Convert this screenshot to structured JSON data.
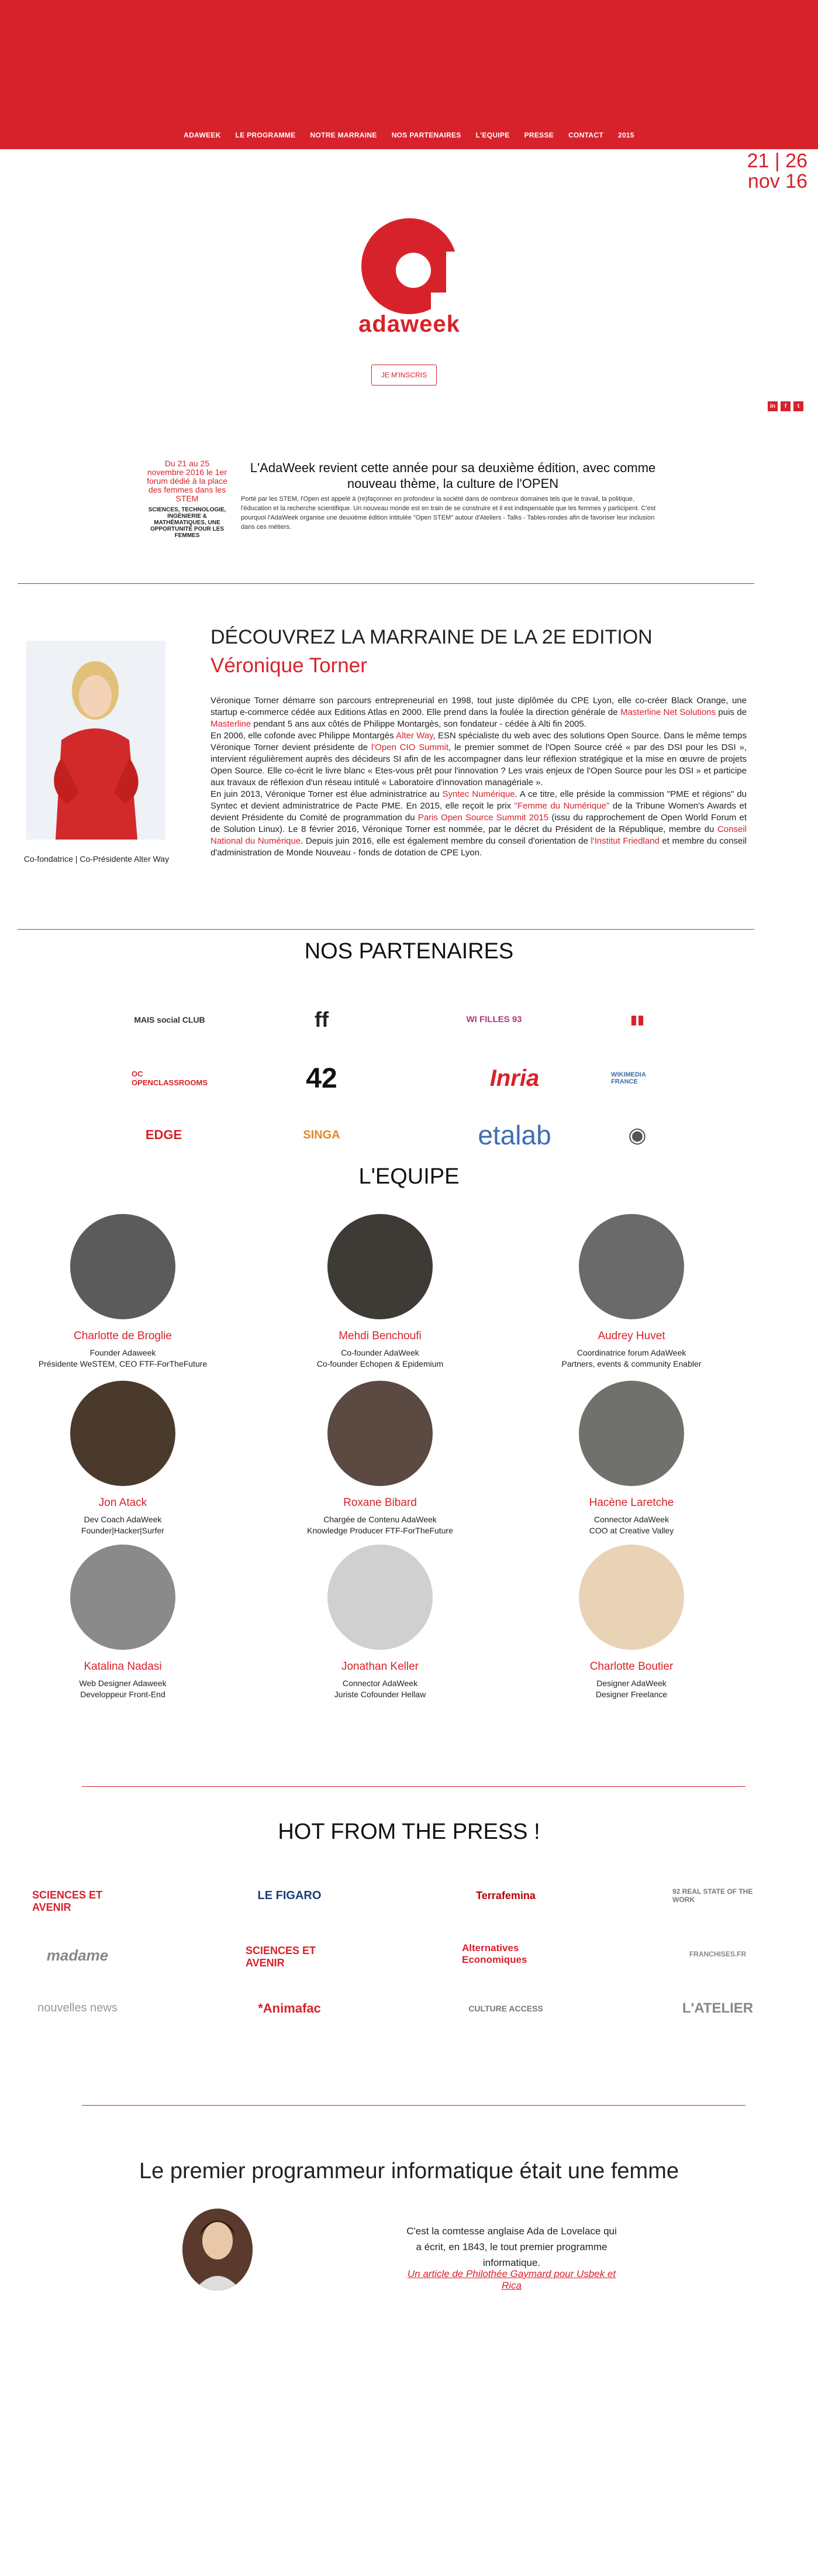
{
  "nav": [
    "ADAWEEK",
    "LE PROGRAMME",
    "NOTRE MARRAINE",
    "NOS PARTENAIRES",
    "L'EQUIPE",
    "PRESSE",
    "CONTACT",
    "2015"
  ],
  "dates": {
    "line1": "21 | 26",
    "line2": "nov 16"
  },
  "logo_text": "adaweek",
  "signup_label": "JE M'INSCRIS",
  "social": [
    "in",
    "f",
    "t"
  ],
  "intro": {
    "side_red": "Du 21 au 25 novembre 2016 le 1er forum dédié à la place des femmes dans les STEM",
    "side_black": "SCIENCES, TECHNOLOGIE, INGÉNIERIE & MATHÉMATIQUES, UNE OPPORTUNITÉ POUR LES FEMMES",
    "title": "L'AdaWeek revient cette année pour sa deuxième édition, avec comme nouveau thème, la culture de l'OPEN",
    "body": "Porté par les STEM, l'Open est appelé à (re)façonner en profondeur la société dans de nombreux domaines tels que le travail, la politique, l'éducation et la recherche scientifique. Un nouveau monde est en train de se construire et il est indispensable que les femmes y participent. C'est pourquoi l'AdaWeek organise une deuxième édition intitulée \"Open STEM\" autour d'Ateliers - Talks - Tables-rondes afin de favoriser leur inclusion dans ces métiers."
  },
  "godmother": {
    "heading": "DÉCOUVREZ LA MARRAINE DE LA 2e EDITION",
    "name": "Véronique Torner",
    "caption": "Co-fondatrice | Co-Présidente Alter Way",
    "p1_a": "Véronique Torner démarre son parcours entrepreneurial en 1998, tout juste diplômée du CPE Lyon, elle co-créer Black Orange, une startup e-commerce cédée aux Editions Atlas en 2000. Elle prend dans la foulée la direction générale de ",
    "p1_l1": "Masterline Net Solutions",
    "p1_b": " puis de ",
    "p1_l2": "Masterline",
    "p1_c": " pendant 5 ans aux côtés de Philippe Montargès, son fondateur - cédée à Alti fin 2005.",
    "p2_a": "En 2006, elle cofonde avec Philippe Montargès ",
    "p2_l1": "Alter Way",
    "p2_b": ", ESN spécialiste du web avec des solutions Open Source. Dans le même temps Véronique Torner devient présidente de ",
    "p2_l2": "l'Open CIO Summit",
    "p2_c": ", le premier sommet de l'Open Source créé « par des DSI pour les DSI », intervient régulièrement auprès des décideurs SI afin de les accompagner dans leur réflexion stratégique et la mise en œuvre de projets Open Source. Elle co-écrit le livre blanc « Etes-vous prêt pour l'innovation ? Les vrais enjeux de l'Open Source pour les DSI » et participe aux travaux de réflexion d'un réseau intitulé « Laboratoire d'innovation managériale ».",
    "p3_a": "En juin 2013, Véronique Torner est élue administratrice au ",
    "p3_l1": "Syntec Numérique",
    "p3_b": ". A ce titre, elle préside la commission \"PME et régions\" du Syntec et devient administratrice de Pacte PME. En 2015, elle reçoit le prix ",
    "p3_l2": "\"Femme du Numérique\"",
    "p3_c": " de la Tribune Women's Awards et devient Présidente du Comité de programmation du ",
    "p3_l3": "Paris Open Source Summit 2015",
    "p3_d": " (issu du rapprochement de Open World Forum et de Solution Linux). Le 8 février 2016, Véronique Torner est nommée, par le décret du Président de la République, membre du ",
    "p3_l4": "Conseil National du Numérique",
    "p3_e": ". Depuis juin 2016, elle est également membre du conseil d'orientation de ",
    "p3_l5": "l'Institut Friedland",
    "p3_f": " et membre du conseil d'administration de Monde Nouveau - fonds de dotation de CPE Lyon."
  },
  "partners_title": "NOS PARTENAIRES",
  "partners": [
    {
      "label": "MAIS social CLUB",
      "color": "#333"
    },
    {
      "label": "ff",
      "color": "#222"
    },
    {
      "label": "WI FILLES 93",
      "color": "#b03a7a"
    },
    {
      "label": "▮▮",
      "color": "#d8222b"
    },
    {
      "label": "OC OPENCLASSROOMS",
      "color": "#d8222b"
    },
    {
      "label": "42",
      "color": "#111"
    },
    {
      "label": "Inria",
      "color": "#d8222b"
    },
    {
      "label": "WIKIMEDIA FRANCE",
      "color": "#3a6fa8"
    },
    {
      "label": "EDGE",
      "color": "#d8222b"
    },
    {
      "label": "SINGA",
      "color": "#e08a2a"
    },
    {
      "label": "etalab",
      "color": "#3b6fb3"
    },
    {
      "label": "◉",
      "color": "#555"
    }
  ],
  "team_title": "L'EQUIPE",
  "team": [
    {
      "name": "Charlotte de Broglie",
      "role1": "Founder Adaweek",
      "role2": "Présidente WeSTEM, CEO FTF-ForTheFuture"
    },
    {
      "name": "Mehdi Benchoufi",
      "role1": "Co-founder AdaWeek",
      "role2": "Co-founder Echopen & Epidemium"
    },
    {
      "name": "Audrey Huvet",
      "role1": "Coordinatrice forum AdaWeek",
      "role2": "Partners, events & community Enabler"
    },
    {
      "name": "Jon Atack",
      "role1": "Dev Coach AdaWeek",
      "role2": "Founder|Hacker|Surfer"
    },
    {
      "name": "Roxane Bibard",
      "role1": "Chargée de Contenu AdaWeek",
      "role2": "Knowledge Producer FTF-ForTheFuture"
    },
    {
      "name": "Hacène Laretche",
      "role1": "Connector AdaWeek",
      "role2": "COO at Creative Valley"
    },
    {
      "name": "Katalina Nadasi",
      "role1": "Web Designer Adaweek",
      "role2": "Developpeur Front-End"
    },
    {
      "name": "Jonathan Keller",
      "role1": "Connector AdaWeek",
      "role2": "Juriste Cofounder Hellaw"
    },
    {
      "name": "Charlotte Boutier",
      "role1": "Designer AdaWeek",
      "role2": "Designer Freelance"
    }
  ],
  "press_title": "HOT FROM THE PRESS !",
  "press": [
    {
      "label": "SCIENCES ET AVENIR",
      "color": "#d8222b"
    },
    {
      "label": "LE FIGARO",
      "color": "#1a3d7a"
    },
    {
      "label": "Terrafemina",
      "color": "#b00"
    },
    {
      "label": "92 REAL STATE OF THE WORK",
      "color": "#777"
    },
    {
      "label": "madame",
      "color": "#888"
    },
    {
      "label": "SCIENCES ET AVENIR",
      "color": "#d8222b"
    },
    {
      "label": "Alternatives Economiques",
      "color": "#d8222b"
    },
    {
      "label": "FRANCHISES.FR",
      "color": "#888"
    },
    {
      "label": "nouvelles news",
      "color": "#999"
    },
    {
      "label": "*Animafac",
      "color": "#d8222b"
    },
    {
      "label": "CULTURE ACCESS",
      "color": "#777"
    },
    {
      "label": "L'ATELIER",
      "color": "#888"
    }
  ],
  "quote": {
    "title": "Le premier programmeur informatique était une femme",
    "text": "C'est la comtesse anglaise Ada de Lovelace qui a écrit, en 1843, le tout premier programme informatique.",
    "link": "Un article de Philothée Gaymard pour Usbek et Rica"
  },
  "colors": {
    "accent": "#d8222b"
  }
}
